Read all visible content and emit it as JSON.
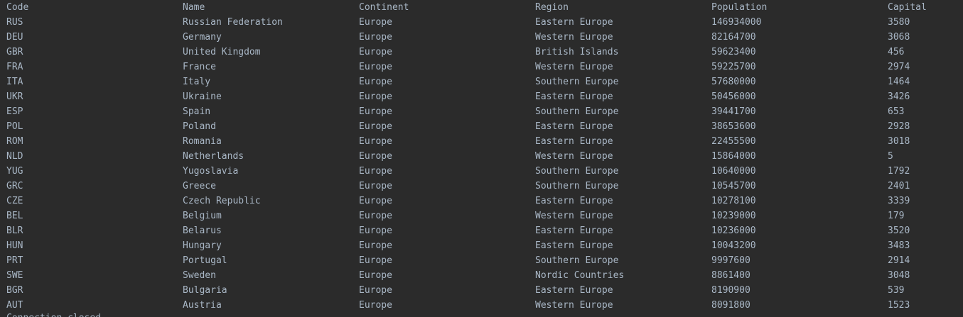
{
  "table": {
    "columns": [
      "Code",
      "Name",
      "Continent",
      "Region",
      "Population",
      "Capital"
    ],
    "rows": [
      [
        "RUS",
        "Russian Federation",
        "Europe",
        "Eastern Europe",
        "146934000",
        "3580"
      ],
      [
        "DEU",
        "Germany",
        "Europe",
        "Western Europe",
        "82164700",
        "3068"
      ],
      [
        "GBR",
        "United Kingdom",
        "Europe",
        "British Islands",
        "59623400",
        "456"
      ],
      [
        "FRA",
        "France",
        "Europe",
        "Western Europe",
        "59225700",
        "2974"
      ],
      [
        "ITA",
        "Italy",
        "Europe",
        "Southern Europe",
        "57680000",
        "1464"
      ],
      [
        "UKR",
        "Ukraine",
        "Europe",
        "Eastern Europe",
        "50456000",
        "3426"
      ],
      [
        "ESP",
        "Spain",
        "Europe",
        "Southern Europe",
        "39441700",
        "653"
      ],
      [
        "POL",
        "Poland",
        "Europe",
        "Eastern Europe",
        "38653600",
        "2928"
      ],
      [
        "ROM",
        "Romania",
        "Europe",
        "Eastern Europe",
        "22455500",
        "3018"
      ],
      [
        "NLD",
        "Netherlands",
        "Europe",
        "Western Europe",
        "15864000",
        "5"
      ],
      [
        "YUG",
        "Yugoslavia",
        "Europe",
        "Southern Europe",
        "10640000",
        "1792"
      ],
      [
        "GRC",
        "Greece",
        "Europe",
        "Southern Europe",
        "10545700",
        "2401"
      ],
      [
        "CZE",
        "Czech Republic",
        "Europe",
        "Eastern Europe",
        "10278100",
        "3339"
      ],
      [
        "BEL",
        "Belgium",
        "Europe",
        "Western Europe",
        "10239000",
        "179"
      ],
      [
        "BLR",
        "Belarus",
        "Europe",
        "Eastern Europe",
        "10236000",
        "3520"
      ],
      [
        "HUN",
        "Hungary",
        "Europe",
        "Eastern Europe",
        "10043200",
        "3483"
      ],
      [
        "PRT",
        "Portugal",
        "Europe",
        "Southern Europe",
        "9997600",
        "2914"
      ],
      [
        "SWE",
        "Sweden",
        "Europe",
        "Nordic Countries",
        "8861400",
        "3048"
      ],
      [
        "BGR",
        "Bulgaria",
        "Europe",
        "Eastern Europe",
        "8190900",
        "539"
      ],
      [
        "AUT",
        "Austria",
        "Europe",
        "Western Europe",
        "8091800",
        "1523"
      ]
    ]
  },
  "footer_text": "Connection closed.",
  "colors": {
    "background": "#2b2b2b",
    "text": "#a9b7c6"
  }
}
